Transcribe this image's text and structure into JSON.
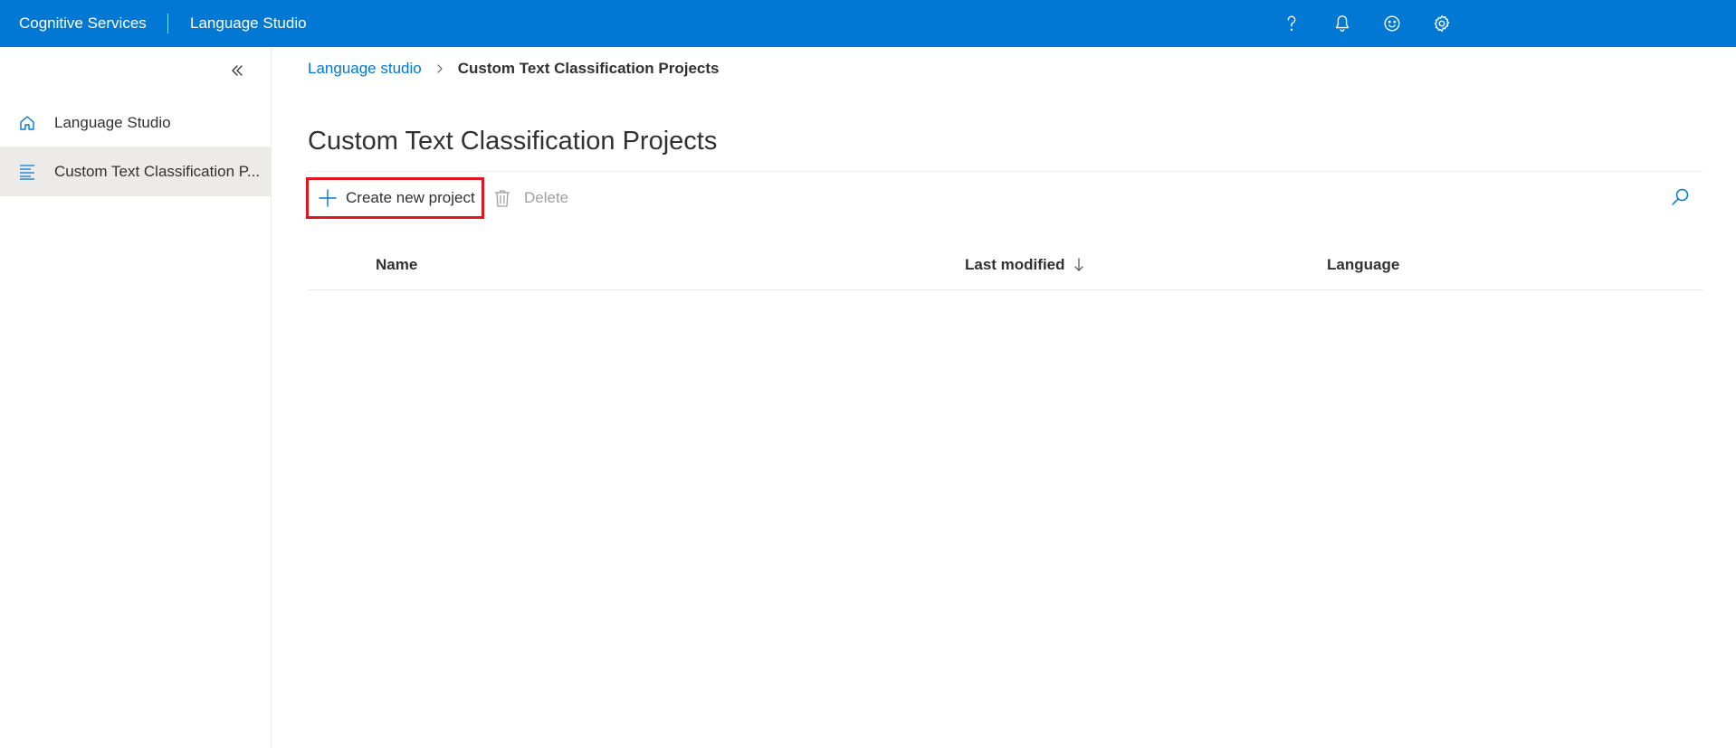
{
  "topbar": {
    "brand": "Cognitive Services",
    "product": "Language Studio",
    "icons": [
      "help-icon",
      "bell-icon",
      "smile-icon",
      "gear-icon"
    ],
    "color": "#0078d4"
  },
  "sidebar": {
    "collapse_icon": "double-chevron-left-icon",
    "items": [
      {
        "label": "Language Studio",
        "icon": "home-icon",
        "active": false
      },
      {
        "label": "Custom Text Classification P...",
        "icon": "list-icon",
        "active": true
      }
    ]
  },
  "breadcrumb": {
    "link": "Language studio",
    "current": "Custom Text Classification Projects"
  },
  "page": {
    "title": "Custom Text Classification Projects"
  },
  "commands": {
    "create_label": "Create new project",
    "delete_label": "Delete",
    "highlight_color": "#e3161f"
  },
  "table": {
    "columns": [
      "Name",
      "Last modified",
      "Language"
    ],
    "sort_column": "Last modified",
    "sort_direction": "descending",
    "rows": []
  }
}
